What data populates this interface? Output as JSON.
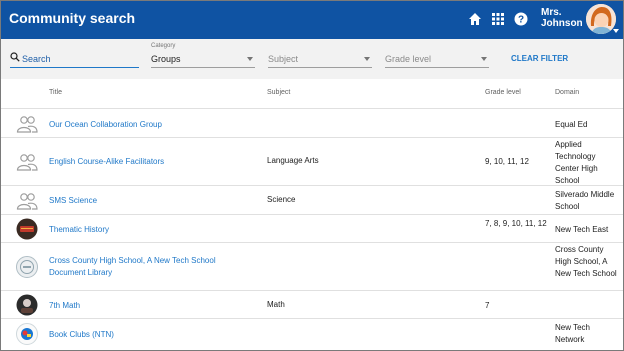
{
  "header": {
    "title": "Community search",
    "user_line1": "Mrs.",
    "user_line2": "Johnson"
  },
  "filters": {
    "search_placeholder": "Search",
    "category_label": "Category",
    "category_value": "Groups",
    "subject_placeholder": "Subject",
    "grade_placeholder": "Grade level",
    "clear_label": "CLEAR FILTER"
  },
  "table": {
    "columns": [
      "Title",
      "Subject",
      "Grade level",
      "Domain"
    ],
    "rows": [
      {
        "icon": "group-icon",
        "title": "Our Ocean Collaboration Group",
        "subject": "",
        "grade": "",
        "domain": "Equal Ed"
      },
      {
        "icon": "group-icon",
        "title": "English Course-Alike Facilitators",
        "subject": "Language Arts",
        "grade": "9, 10, 11, 12",
        "domain": "Applied Technology Center High School"
      },
      {
        "icon": "group-icon",
        "title": "SMS Science",
        "subject": "Science",
        "grade": "",
        "domain": "Silverado Middle School"
      },
      {
        "icon": "thematic-history-thumbnail",
        "title": "Thematic History",
        "subject": "",
        "grade": "7, 8, 9, 10, 11, 12",
        "domain": "New Tech East"
      },
      {
        "icon": "school-logo-thumbnail",
        "title": "Cross County High School, A New Tech School Document Library",
        "subject": "",
        "grade": "",
        "domain": "Cross County High School, A New Tech School"
      },
      {
        "icon": "math-thumbnail",
        "title": "7th Math",
        "subject": "Math",
        "grade": "7",
        "domain": ""
      },
      {
        "icon": "book-clubs-thumbnail",
        "title": "Book Clubs (NTN)",
        "subject": "",
        "grade": "",
        "domain": "New Tech Network"
      }
    ]
  }
}
